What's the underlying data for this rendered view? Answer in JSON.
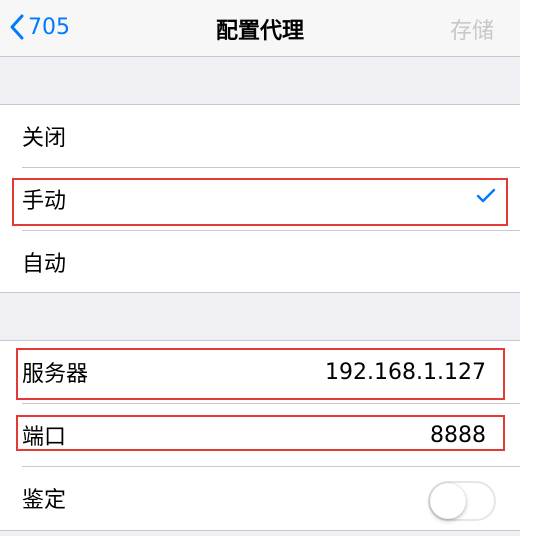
{
  "nav": {
    "back_label": "705",
    "title": "配置代理",
    "save_label": "存储"
  },
  "proxy_modes": [
    {
      "label": "关闭",
      "selected": false
    },
    {
      "label": "手动",
      "selected": true
    },
    {
      "label": "自动",
      "selected": false
    }
  ],
  "manual": {
    "server_label": "服务器",
    "server_value": "192.168.1.127",
    "port_label": "端口",
    "port_value": "8888",
    "auth_label": "鉴定",
    "auth_enabled": false
  },
  "colors": {
    "accent": "#007aff",
    "highlight": "#e53935",
    "disabled_text": "#c7c7cc",
    "background": "#efeff4"
  },
  "icons": {
    "back": "chevron-left-icon",
    "check": "checkmark-icon"
  }
}
